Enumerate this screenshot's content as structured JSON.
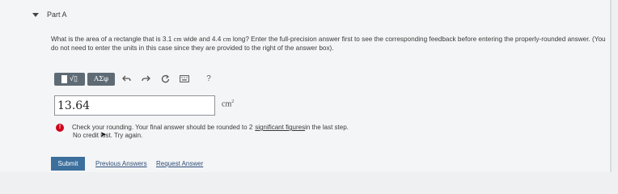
{
  "part": {
    "title": "Part A"
  },
  "question": {
    "text_before": "What is the area of a rectangle that is 3.1 ",
    "unit_cm_1": "cm",
    "text_mid": " wide and 4.4 ",
    "unit_cm_2": "cm",
    "text_after": " long? Enter the full-precision answer first to see the corresponding feedback before entering the properly-rounded answer. (You do not need to enter the units in this case since they are provided to the right of the answer box)."
  },
  "toolbar": {
    "template_label": "√▯",
    "greek_label": "ΑΣφ",
    "undo_icon": "undo-icon",
    "redo_icon": "redo-icon",
    "reset_icon": "reset-icon",
    "keyboard_icon": "keyboard-icon",
    "help_label": "?"
  },
  "answer": {
    "value": "13.64",
    "unit": "cm",
    "unit_exponent": "2"
  },
  "feedback": {
    "line1_prefix": "Check your rounding. Your final answer should be rounded to 2 ",
    "line1_link": "significant figures",
    "line1_suffix": " in the last step.",
    "line2": "No credit lost. Try again."
  },
  "actions": {
    "submit_label": "Submit",
    "previous_answers_label": "Previous Answers",
    "request_answer_label": "Request Answer"
  },
  "colors": {
    "submit_bg": "#3c6f9c",
    "toolbar_bg": "#5e6b75",
    "alert": "#d0021b"
  }
}
